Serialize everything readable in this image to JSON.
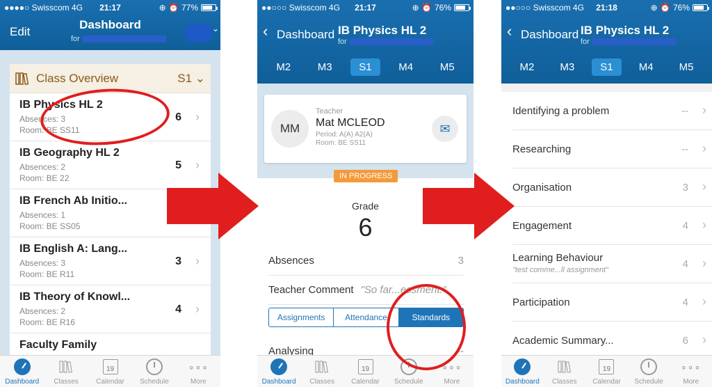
{
  "status1": {
    "carrier": "●●●●○ Swisscom  4G",
    "time": "21:17",
    "battery": "77%",
    "battery_level": 0.77
  },
  "status2": {
    "carrier": "●●○○○ Swisscom  4G",
    "time": "21:17",
    "battery": "76%",
    "battery_level": 0.76
  },
  "status3": {
    "carrier": "●●○○○ Swisscom  4G",
    "time": "21:18",
    "battery": "76%",
    "battery_level": 0.76
  },
  "screen1": {
    "nav_left": "Edit",
    "nav_title": "Dashboard",
    "nav_sub": "for",
    "overview_title": "Class Overview",
    "semester": "S1 ⌄",
    "classes": [
      {
        "name": "IB Physics HL 2",
        "absences": "Absences: 3",
        "room": "Room: BE SS11",
        "grade": "6"
      },
      {
        "name": "IB Geography HL 2",
        "absences": "Absences: 2",
        "room": "Room: BE 22",
        "grade": "5"
      },
      {
        "name": "IB French Ab Initio...",
        "absences": "Absences: 1",
        "room": "Room: BE SS05",
        "grade": ""
      },
      {
        "name": "IB English A: Lang...",
        "absences": "Absences: 3",
        "room": "Room: BE R11",
        "grade": "3"
      },
      {
        "name": "IB Theory of Knowl...",
        "absences": "Absences: 2",
        "room": "Room: BE R16",
        "grade": "4"
      },
      {
        "name": "Faculty Family",
        "absences": "",
        "room": "",
        "grade": "--"
      }
    ]
  },
  "screen2": {
    "back": "Dashboard",
    "title": "IB Physics HL 2",
    "title_sub": "for",
    "segments": [
      "M2",
      "M3",
      "S1",
      "M4",
      "M5"
    ],
    "teacher_role": "Teacher",
    "teacher_initials": "MM",
    "teacher_name": "Mat MCLEOD",
    "teacher_period": "Period: A(A) A2(A)",
    "teacher_room": "Room: BE SS11",
    "badge": "IN PROGRESS",
    "grade_label": "Grade",
    "grade_value": "6",
    "absences_label": "Absences",
    "absences_value": "3",
    "comment_label": "Teacher Comment",
    "comment_value": "\"So far...essment.\"",
    "tabs": [
      "Assignments",
      "Attendance",
      "Standards"
    ],
    "first_standard": "Analysing",
    "first_standard_value": "--"
  },
  "screen3": {
    "back": "Dashboard",
    "title": "IB Physics HL 2",
    "title_sub": "for",
    "segments": [
      "M2",
      "M3",
      "S1",
      "M4",
      "M5"
    ],
    "standards": [
      {
        "label": "Identifying a problem",
        "value": "--",
        "sub": ""
      },
      {
        "label": "Researching",
        "value": "--",
        "sub": ""
      },
      {
        "label": "Organisation",
        "value": "3",
        "sub": ""
      },
      {
        "label": "Engagement",
        "value": "4",
        "sub": ""
      },
      {
        "label": "Learning Behaviour",
        "value": "4",
        "sub": "\"test comme...ll assignment\""
      },
      {
        "label": "Participation",
        "value": "4",
        "sub": ""
      },
      {
        "label": "Academic Summary...",
        "value": "6",
        "sub": ""
      }
    ]
  },
  "tabbar": {
    "items": [
      {
        "label": "Dashboard",
        "icon": "dashboard-gauge-icon"
      },
      {
        "label": "Classes",
        "icon": "books-icon"
      },
      {
        "label": "Calendar",
        "icon": "calendar-icon",
        "day": "19"
      },
      {
        "label": "Schedule",
        "icon": "clock-icon"
      },
      {
        "label": "More",
        "icon": "more-dots-icon"
      }
    ]
  },
  "colors": {
    "header_blue": "#1a6fb0",
    "header_gradient_end": "#0f5f99",
    "segment_active": "#2b8fd3",
    "annotation_red": "#e01e1e",
    "badge_orange": "#f39a3a"
  }
}
